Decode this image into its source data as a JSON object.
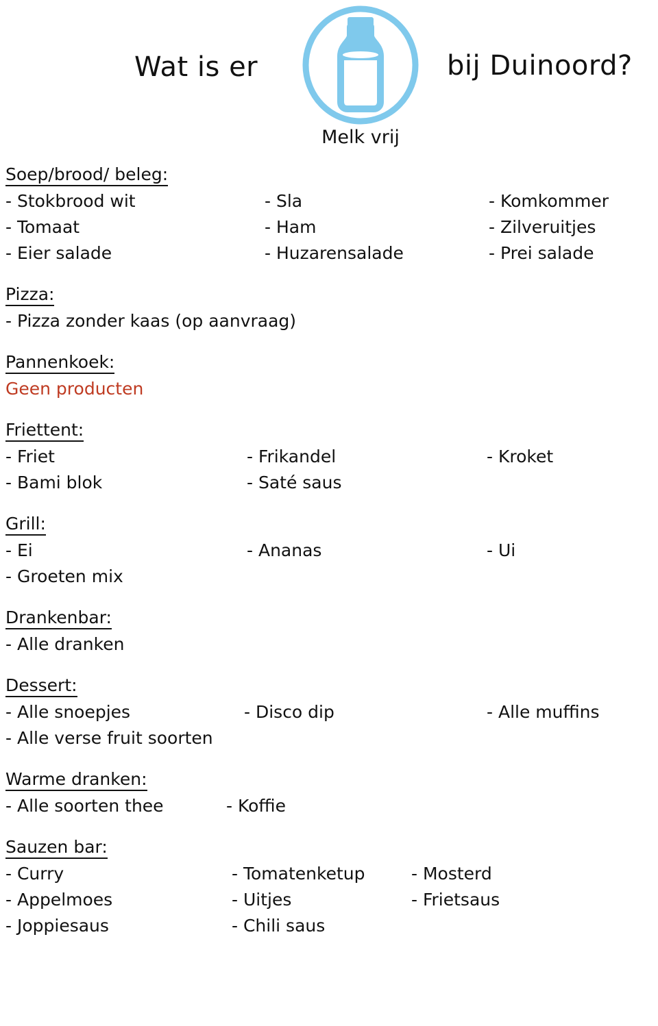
{
  "header": {
    "title_left": "Wat is er",
    "title_right": "bij Duinoord?",
    "badge_caption": "Melk vrij",
    "badge_icon": "milk-bottle-icon",
    "badge_color": "#7fc9ec"
  },
  "colors": {
    "text": "#111111",
    "accent_blue": "#7fc9ec",
    "warning_red": "#bf3b22"
  },
  "sections": [
    {
      "id": "soep-brood-beleg",
      "title": "Soep/brood/ beleg:",
      "rows": [
        [
          "- Stokbrood wit",
          "- Sla",
          "- Komkommer"
        ],
        [
          "- Tomaat",
          "- Ham",
          "- Zilveruitjes"
        ],
        [
          "- Eier salade",
          "- Huzarensalade",
          "- Prei salade"
        ]
      ]
    },
    {
      "id": "pizza",
      "title": "Pizza:",
      "rows": [
        [
          "- Pizza zonder kaas (op aanvraag)",
          "",
          ""
        ]
      ]
    },
    {
      "id": "pannenkoek",
      "title": "Pannenkoek:",
      "note": "Geen producten",
      "rows": []
    },
    {
      "id": "friettent",
      "title": "Friettent:",
      "rows": [
        [
          "- Friet",
          "- Frikandel",
          "- Kroket"
        ],
        [
          "- Bami blok",
          "- Saté saus",
          ""
        ]
      ]
    },
    {
      "id": "grill",
      "title": "Grill:",
      "rows": [
        [
          "- Ei",
          "- Ananas",
          "- Ui"
        ],
        [
          "- Groeten mix",
          "",
          ""
        ]
      ]
    },
    {
      "id": "drankenbar",
      "title": "Drankenbar:",
      "rows": [
        [
          "- Alle dranken",
          "",
          ""
        ]
      ]
    },
    {
      "id": "dessert",
      "title": "Dessert:",
      "rows": [
        [
          "- Alle snoepjes",
          "- Disco dip",
          "- Alle muffins"
        ],
        [
          "- Alle verse fruit soorten",
          "",
          ""
        ]
      ]
    },
    {
      "id": "warme-dranken",
      "title": "Warme dranken:",
      "rows": [
        [
          "- Alle soorten thee",
          "- Koffie",
          ""
        ]
      ]
    },
    {
      "id": "sauzen-bar",
      "title": "Sauzen bar:",
      "rows": [
        [
          "- Curry",
          "- Tomatenketup",
          "- Mosterd"
        ],
        [
          "- Appelmoes",
          "- Uitjes",
          "- Frietsaus"
        ],
        [
          "- Joppiesaus",
          "- Chili saus",
          ""
        ]
      ]
    }
  ]
}
